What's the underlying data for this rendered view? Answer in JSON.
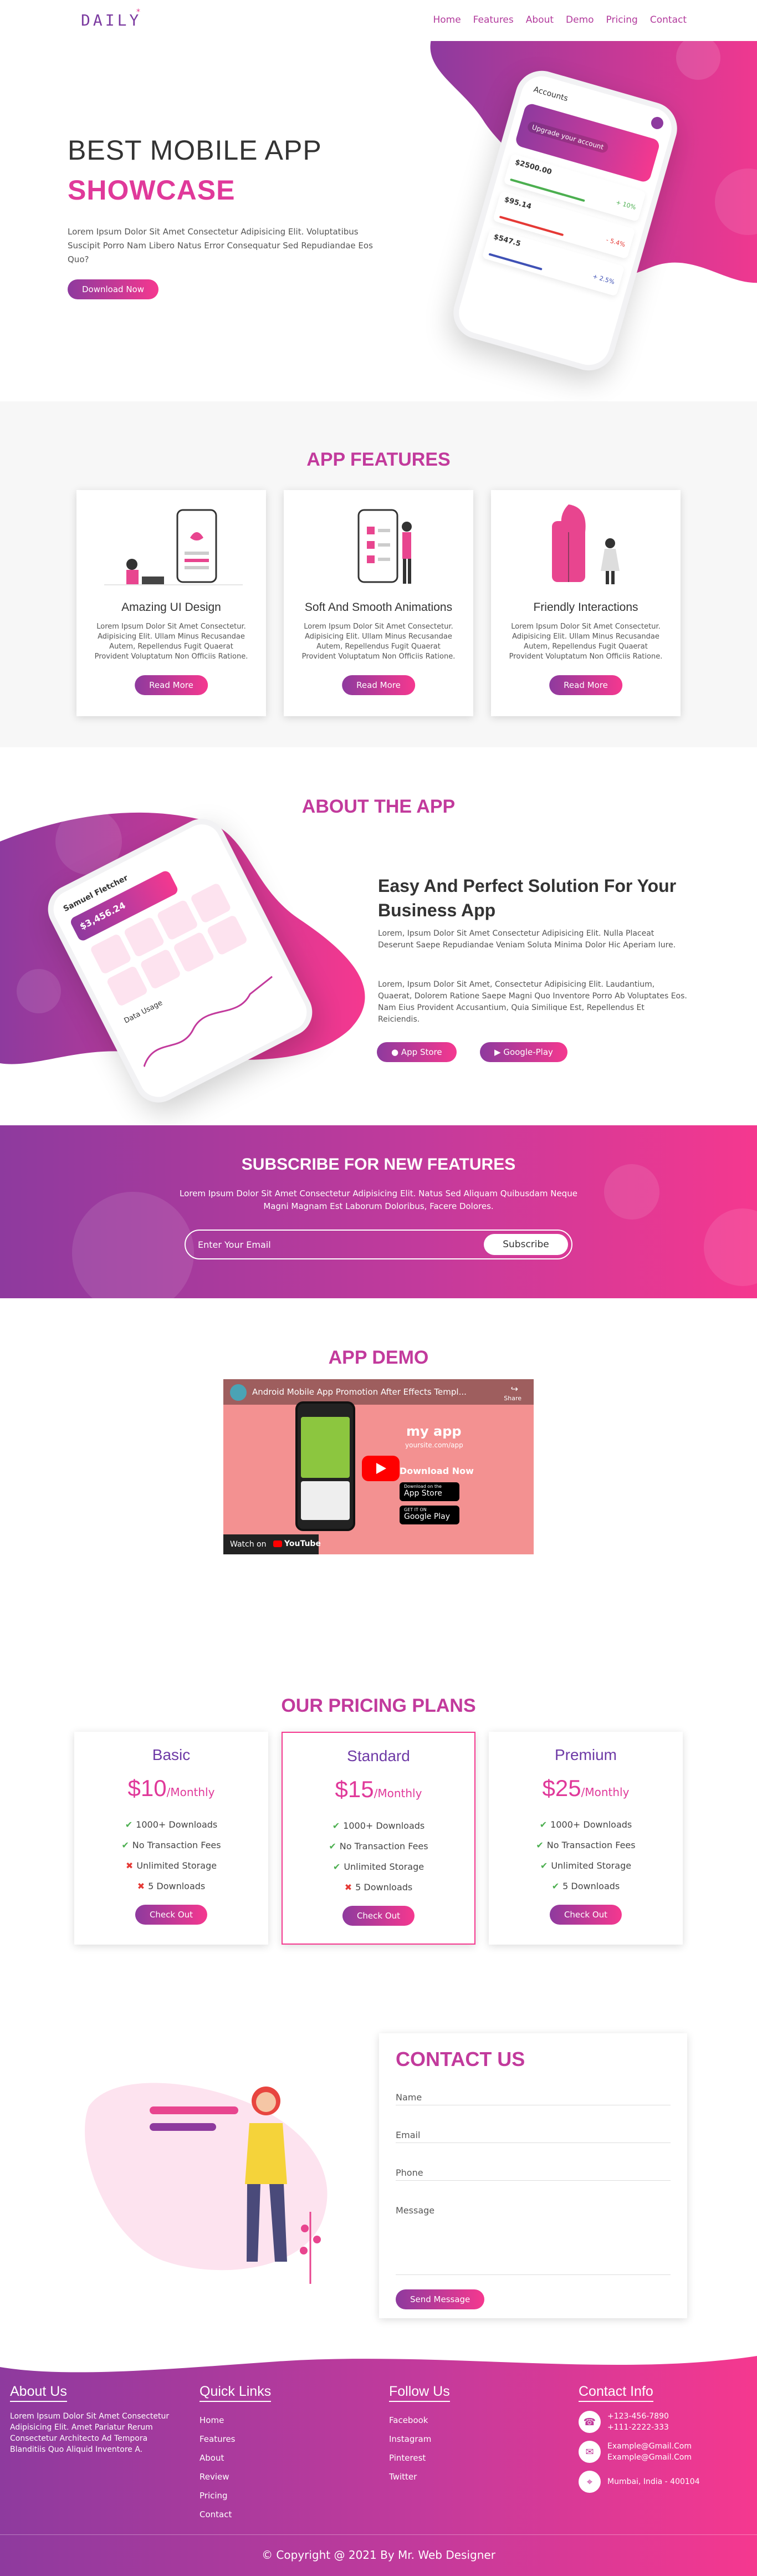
{
  "brand": {
    "logo": "DAILY",
    "logo_mark": "*"
  },
  "colors": {
    "primary": "#8e3a9e",
    "accent": "#f5388f",
    "heading": "#c23a9c"
  },
  "nav": {
    "items": [
      "Home",
      "Features",
      "About",
      "Demo",
      "Pricing",
      "Contact"
    ]
  },
  "hero": {
    "title_line1": "BEST MOBILE APP",
    "title_line2": "SHOWCASE",
    "text": "Lorem Ipsum Dolor Sit Amet Consectetur Adipisicing Elit. Voluptatibus Suscipit Porro Nam Libero Natus Error Consequatur Sed Repudiandae Eos Quo?",
    "button": "Download Now",
    "phone": {
      "title": "Accounts",
      "banner": "Upgrade your account",
      "cards": [
        {
          "amount": "$2500.00",
          "pct": "+ 10%"
        },
        {
          "amount": "$95.14",
          "pct": "- 5.4%"
        },
        {
          "amount": "$547.5",
          "pct": "+ 2.5%"
        }
      ]
    }
  },
  "features": {
    "title": "APP FEATURES",
    "cards": [
      {
        "title": "Amazing UI Design",
        "text": "Lorem Ipsum Dolor Sit Amet Consectetur. Adipisicing Elit. Ullam Minus Recusandae Autem, Repellendus Fugit Quaerat Provident Voluptatum Non Officiis Ratione.",
        "button": "Read More"
      },
      {
        "title": "Soft And Smooth Animations",
        "text": "Lorem Ipsum Dolor Sit Amet Consectetur. Adipisicing Elit. Ullam Minus Recusandae Autem, Repellendus Fugit Quaerat Provident Voluptatum Non Officiis Ratione.",
        "button": "Read More"
      },
      {
        "title": "Friendly Interactions",
        "text": "Lorem Ipsum Dolor Sit Amet Consectetur. Adipisicing Elit. Ullam Minus Recusandae Autem, Repellendus Fugit Quaerat Provident Voluptatum Non Officiis Ratione.",
        "button": "Read More"
      }
    ]
  },
  "about": {
    "title": "ABOUT THE APP",
    "heading": "Easy And Perfect Solution For Your Business App",
    "para1": "Lorem, Ipsum Dolor Sit Amet Consectetur Adipisicing Elit. Nulla Placeat Deserunt Saepe Repudiandae Veniam Soluta Minima Dolor Hic Aperiam Iure.",
    "para2": "Lorem, Ipsum Dolor Sit Amet, Consectetur Adipisicing Elit. Laudantium, Quaerat, Dolorem Ratione Saepe Magni Quo Inventore Porro Ab Voluptates Eos. Nam Eius Provident Accusantium, Quia Similique Est, Repellendus Et Reiciendis.",
    "app_store": "App Store",
    "google_play": "Google-Play",
    "phone": {
      "name": "Samuel Fletcher",
      "balance": "$3,456.24",
      "chart_label": "Data Usage"
    }
  },
  "subscribe": {
    "title": "SUBSCRIBE FOR NEW FEATURES",
    "text": "Lorem Ipsum Dolor Sit Amet Consectetur Adipisicing Elit. Natus Sed Aliquam Quibusdam Neque Magni Magnam Est Laborum Doloribus, Facere Dolores.",
    "placeholder": "Enter Your Email",
    "button": "Subscribe"
  },
  "demo": {
    "title": "APP DEMO",
    "video_title": "Android Mobile App Promotion After Effects Templ...",
    "share": "Share",
    "app_name": "my app",
    "app_site": "yoursite.com/app",
    "download": "Download Now",
    "store1_small": "Download on the",
    "store1": "App Store",
    "store2_small": "GET IT ON",
    "store2": "Google Play",
    "watch_on": "Watch on",
    "youtube": "YouTube"
  },
  "pricing": {
    "title": "OUR PRICING PLANS",
    "plans": [
      {
        "name": "Basic",
        "price": "$10",
        "period": "/Monthly",
        "features": [
          {
            "text": "1000+ Downloads",
            "ok": true
          },
          {
            "text": "No Transaction Fees",
            "ok": true
          },
          {
            "text": "Unlimited Storage",
            "ok": false
          },
          {
            "text": "5 Downloads",
            "ok": false
          }
        ],
        "button": "Check Out"
      },
      {
        "name": "Standard",
        "price": "$15",
        "period": "/Monthly",
        "features": [
          {
            "text": "1000+ Downloads",
            "ok": true
          },
          {
            "text": "No Transaction Fees",
            "ok": true
          },
          {
            "text": "Unlimited Storage",
            "ok": true
          },
          {
            "text": "5 Downloads",
            "ok": false
          }
        ],
        "button": "Check Out"
      },
      {
        "name": "Premium",
        "price": "$25",
        "period": "/Monthly",
        "features": [
          {
            "text": "1000+ Downloads",
            "ok": true
          },
          {
            "text": "No Transaction Fees",
            "ok": true
          },
          {
            "text": "Unlimited Storage",
            "ok": true
          },
          {
            "text": "5 Downloads",
            "ok": true
          }
        ],
        "button": "Check Out"
      }
    ]
  },
  "contact": {
    "title": "CONTACT US",
    "name_ph": "Name",
    "email_ph": "Email",
    "phone_ph": "Phone",
    "message_ph": "Message",
    "button": "Send Message"
  },
  "footer": {
    "about_title": "About Us",
    "about_text": "Lorem Ipsum Dolor Sit Amet Consectetur Adipisicing Elit. Amet Pariatur Rerum Consectetur Architecto Ad Tempora Blanditiis Quo Aliquid Inventore A.",
    "links_title": "Quick Links",
    "links": [
      "Home",
      "Features",
      "About",
      "Review",
      "Pricing",
      "Contact"
    ],
    "follow_title": "Follow Us",
    "follow": [
      "Facebook",
      "Instagram",
      "Pinterest",
      "Twitter"
    ],
    "info_title": "Contact Info",
    "phone1": "+123-456-7890",
    "phone2": "+111-2222-333",
    "email1": "Example@Gmail.Com",
    "email2": "Example@Gmail.Com",
    "address": "Mumbai, India - 400104",
    "copyright": "© Copyright @ 2021 By Mr. Web Designer"
  }
}
